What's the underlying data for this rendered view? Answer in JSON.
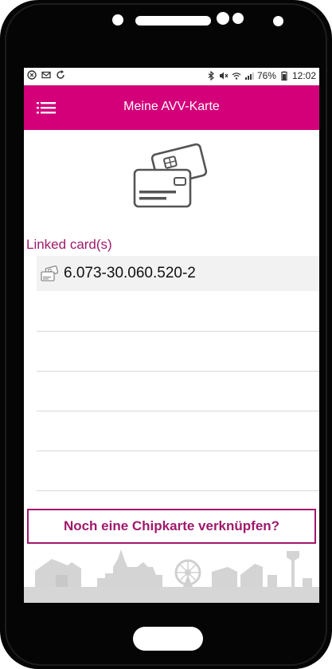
{
  "status_bar": {
    "battery_percent": "76%",
    "time": "12:02"
  },
  "app_bar": {
    "title": "Meine AVV-Karte"
  },
  "linked_cards": {
    "label": "Linked card(s)",
    "items": [
      {
        "number": "6.073-30.060.520-2"
      }
    ]
  },
  "actions": {
    "link_card_button": "Noch eine Chipkarte verknüpfen?"
  },
  "colors": {
    "primary": "#d4007a",
    "accent": "#a0196b"
  }
}
